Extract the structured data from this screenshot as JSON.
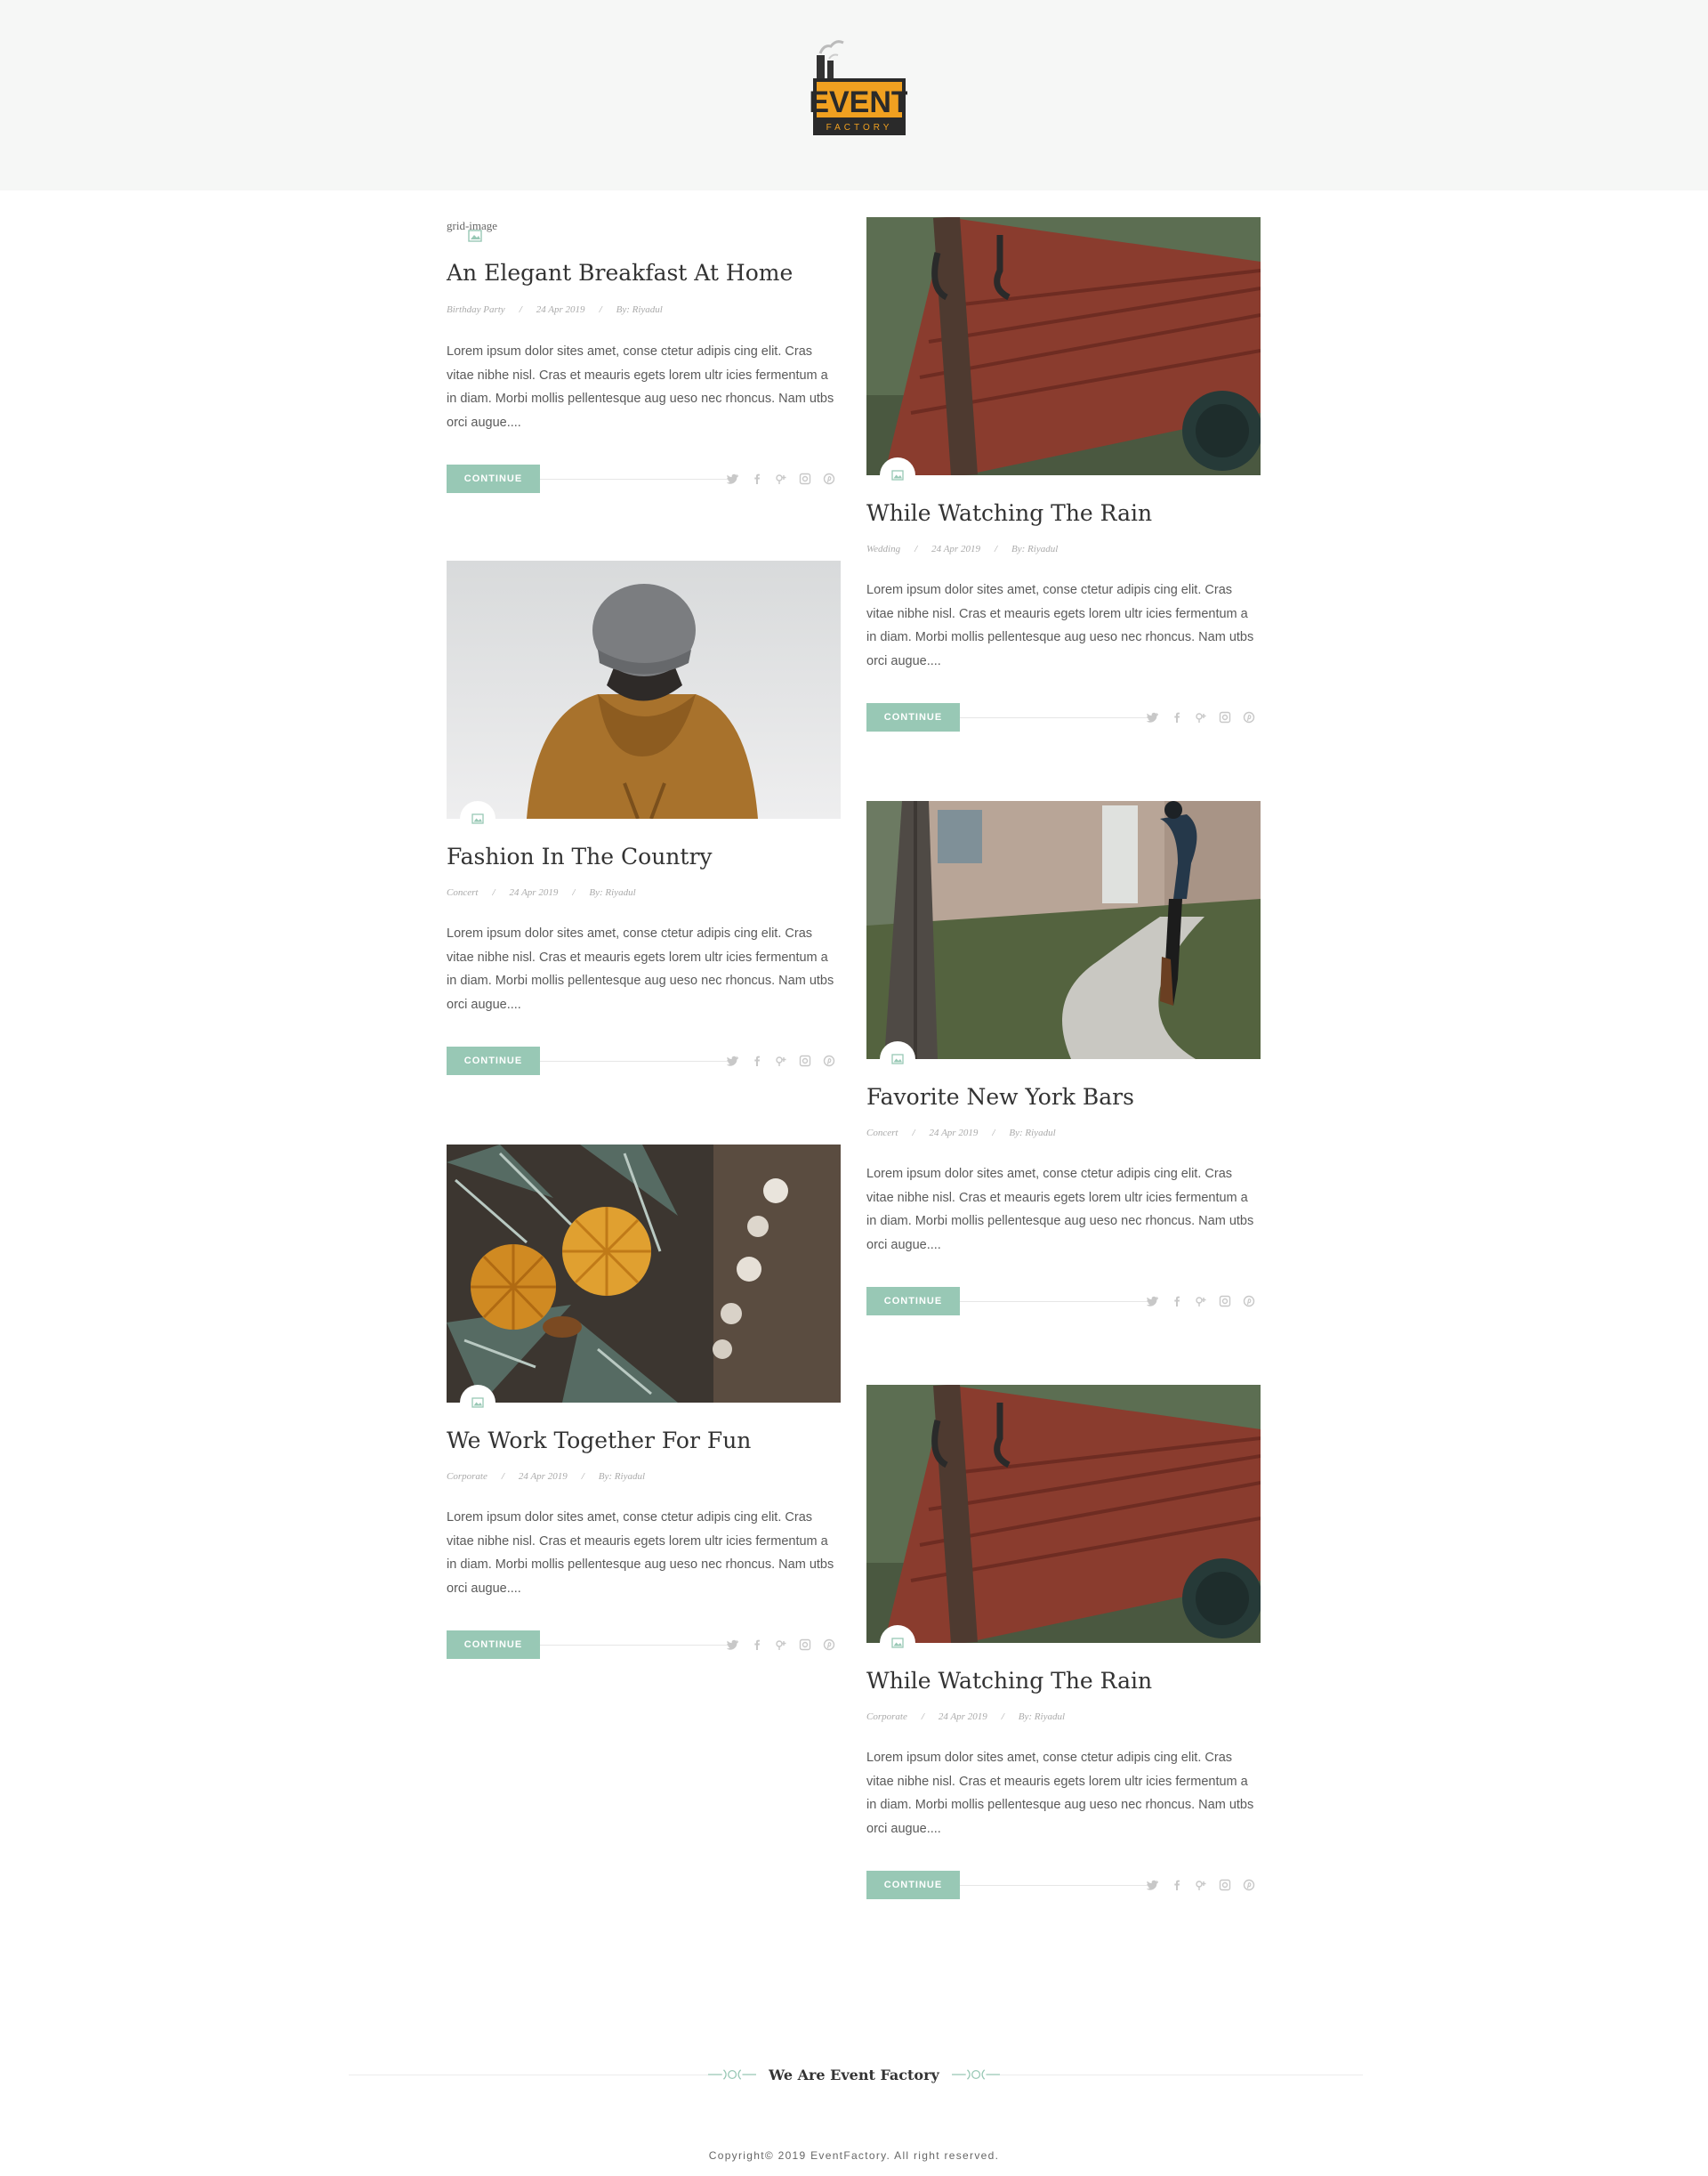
{
  "header": {
    "logo": {
      "word": "EVENT",
      "subword": "FACTORY"
    }
  },
  "broken_image_alt": "grid-image",
  "posts": [
    {
      "title": "An Elegant Breakfast At Home",
      "category": "Birthday Party",
      "date": "24 Apr 2019",
      "author": "By: Riyadul",
      "excerpt": "Lorem ipsum dolor sites amet, conse ctetur adipis cing elit. Cras vitae nibhe nisl. Cras et meauris egets lorem ultr icies fermentum a in diam. Morbi mollis pellentesque aug ueso nec rhoncus. Nam utbs orci augue....",
      "continue": "CONTINUE",
      "image": "broken"
    },
    {
      "title": "While Watching The Rain",
      "category": "Wedding",
      "date": "24 Apr 2019",
      "author": "By: Riyadul",
      "excerpt": "Lorem ipsum dolor sites amet, conse ctetur adipis cing elit. Cras vitae nibhe nisl. Cras et meauris egets lorem ultr icies fermentum a in diam. Morbi mollis pellentesque aug ueso nec rhoncus. Nam utbs orci augue....",
      "continue": "CONTINUE",
      "image": "wooden-cart"
    },
    {
      "title": "Fashion In The Country",
      "category": "Concert",
      "date": "24 Apr 2019",
      "author": "By: Riyadul",
      "excerpt": "Lorem ipsum dolor sites amet, conse ctetur adipis cing elit. Cras vitae nibhe nisl. Cras et meauris egets lorem ultr icies fermentum a in diam. Morbi mollis pellentesque aug ueso nec rhoncus. Nam utbs orci augue....",
      "continue": "CONTINUE",
      "image": "person-in-beanie"
    },
    {
      "title": "Favorite New York Bars",
      "category": "Concert",
      "date": "24 Apr 2019",
      "author": "By: Riyadul",
      "excerpt": "Lorem ipsum dolor sites amet, conse ctetur adipis cing elit. Cras vitae nibhe nisl. Cras et meauris egets lorem ultr icies fermentum a in diam. Morbi mollis pellentesque aug ueso nec rhoncus. Nam utbs orci augue....",
      "continue": "CONTINUE",
      "image": "woman-walking-path"
    },
    {
      "title": "We Work Together For Fun",
      "category": "Corporate",
      "date": "24 Apr 2019",
      "author": "By: Riyadul",
      "excerpt": "Lorem ipsum dolor sites amet, conse ctetur adipis cing elit. Cras vitae nibhe nisl. Cras et meauris egets lorem ultr icies fermentum a in diam. Morbi mollis pellentesque aug ueso nec rhoncus. Nam utbs orci augue....",
      "continue": "CONTINUE",
      "image": "dried-oranges"
    },
    {
      "title": "While Watching The Rain",
      "category": "Corporate",
      "date": "24 Apr 2019",
      "author": "By: Riyadul",
      "excerpt": "Lorem ipsum dolor sites amet, conse ctetur adipis cing elit. Cras vitae nibhe nisl. Cras et meauris egets lorem ultr icies fermentum a in diam. Morbi mollis pellentesque aug ueso nec rhoncus. Nam utbs orci augue....",
      "continue": "CONTINUE",
      "image": "wooden-cart"
    }
  ],
  "share_icons": [
    "twitter-icon",
    "facebook-icon",
    "google-plus-icon",
    "instagram-icon",
    "pinterest-icon"
  ],
  "footer": {
    "brand": "We Are Event Factory",
    "copyright": "Copyright© 2019 EventFactory. All right reserved."
  },
  "colors": {
    "accent": "#98c8b5",
    "header_bg": "#f6f7f6",
    "logo_orange": "#f0a020",
    "logo_dark": "#2a2a2a"
  }
}
